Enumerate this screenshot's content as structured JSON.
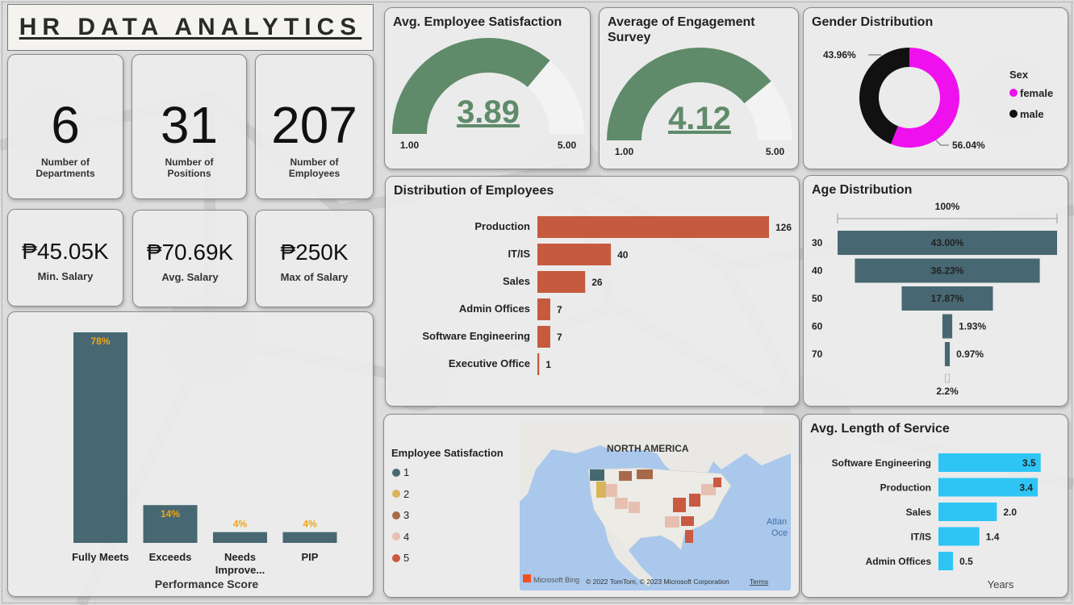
{
  "header": {
    "title": "HR DATA ANALYTICS"
  },
  "kpis": {
    "departments": {
      "value": "6",
      "label": "Number of Departments"
    },
    "positions": {
      "value": "31",
      "label": "Number of Positions"
    },
    "employees": {
      "value": "207",
      "label": "Number of Employees"
    },
    "min_salary": {
      "value": "₱45.05K",
      "label": "Min. Salary"
    },
    "avg_salary": {
      "value": "₱70.69K",
      "label": "Avg. Salary"
    },
    "max_salary": {
      "value": "₱250K",
      "label": "Max of Salary"
    }
  },
  "satisfaction_gauge": {
    "title": "Avg. Employee Satisfaction",
    "value": 3.89,
    "value_label": "3.89",
    "min": 1.0,
    "max": 5.0,
    "min_label": "1.00",
    "max_label": "5.00",
    "color": "#5f8b6a"
  },
  "engagement_gauge": {
    "title": "Average of Engagement Survey",
    "value": 4.12,
    "value_label": "4.12",
    "min": 1.0,
    "max": 5.0,
    "min_label": "1.00",
    "max_label": "5.00",
    "color": "#5f8b6a"
  },
  "map": {
    "legend_title": "Employee Satisfaction",
    "legend": [
      {
        "label": "1",
        "color": "#47686e"
      },
      {
        "label": "2",
        "color": "#d9b45a"
      },
      {
        "label": "3",
        "color": "#a8694a"
      },
      {
        "label": "4",
        "color": "#e7bfb0"
      },
      {
        "label": "5",
        "color": "#c95a42"
      }
    ],
    "region_label": "NORTH AMERICA",
    "ocean_label": "Atlan\nOce",
    "bing_label": "Microsoft Bing",
    "copyright": "© 2022 TomTom, © 2023 Microsoft Corporation",
    "terms": "Terms"
  },
  "chart_data": [
    {
      "id": "gender",
      "type": "pie",
      "title": "Gender Distribution",
      "legend_title": "Sex",
      "categories": [
        "female",
        "male"
      ],
      "values": [
        56.04,
        43.96
      ],
      "value_labels": [
        "56.04%",
        "43.96%"
      ],
      "colors": [
        "#ee11ee",
        "#111111"
      ]
    },
    {
      "id": "departments",
      "type": "bar",
      "title": "Distribution of Employees",
      "categories": [
        "Production",
        "IT/IS",
        "Sales",
        "Admin Offices",
        "Software Engineering",
        "Executive Office"
      ],
      "values": [
        126,
        40,
        26,
        7,
        7,
        1
      ],
      "color": "#c65a3e"
    },
    {
      "id": "age",
      "type": "bar",
      "title": "Age Distribution",
      "categories": [
        "30",
        "40",
        "50",
        "60",
        "70",
        ""
      ],
      "values": [
        43.0,
        36.23,
        17.87,
        1.93,
        0.97,
        2.2
      ],
      "value_labels": [
        "43.00%",
        "36.23%",
        "17.87%",
        "1.93%",
        "0.97%",
        "2.2%"
      ],
      "top_label": "100%",
      "color": "#476872"
    },
    {
      "id": "performance",
      "type": "bar",
      "xlabel": "Performance Score",
      "categories": [
        "Fully Meets",
        "Exceeds",
        "Needs Improve...",
        "PIP"
      ],
      "values": [
        78,
        14,
        4,
        4
      ],
      "value_labels": [
        "78%",
        "14%",
        "4%",
        "4%"
      ],
      "color": "#476872",
      "label_color": "#f2a516"
    },
    {
      "id": "service",
      "type": "bar",
      "title": "Avg. Length of Service",
      "xlabel": "Years",
      "categories": [
        "Software Engineering",
        "Production",
        "Sales",
        "IT/IS",
        "Admin Offices"
      ],
      "values": [
        3.5,
        3.4,
        2.0,
        1.4,
        0.5
      ],
      "value_labels": [
        "3.5",
        "3.4",
        "2.0",
        "1.4",
        "0.5"
      ],
      "color": "#2ec5f5"
    }
  ]
}
